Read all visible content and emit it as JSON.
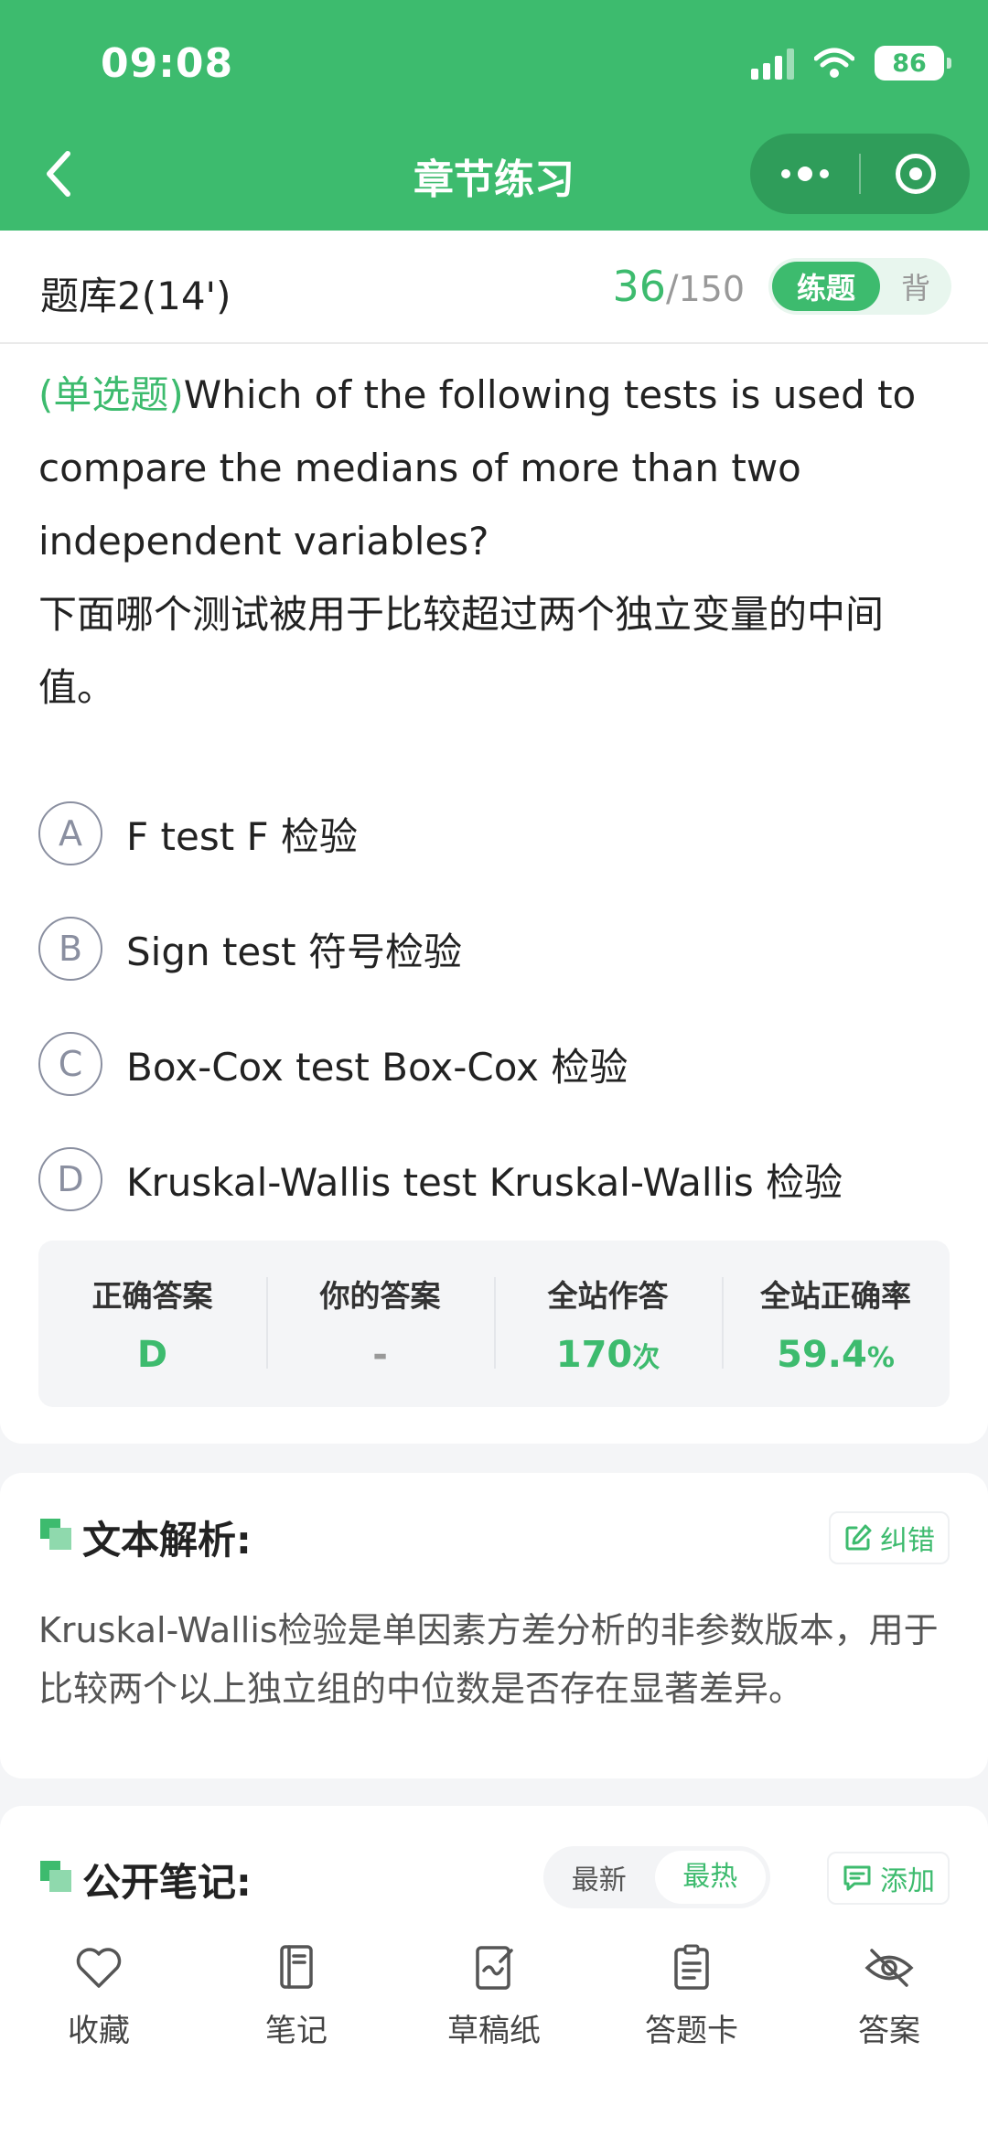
{
  "status_bar": {
    "time": "09:08",
    "battery": "86"
  },
  "nav": {
    "title": "章节练习"
  },
  "bank": {
    "name": "题库2(14')",
    "current": "36",
    "separator": "/",
    "total": "150",
    "mode_active": "练题",
    "mode_inactive": "背"
  },
  "question": {
    "type_tag": "(单选题)",
    "text_en": "Which of the following tests is used to compare the medians of more than two independent variables?",
    "text_zh": "下面哪个测试被用于比较超过两个独立变量的中间值。"
  },
  "options": [
    {
      "letter": "A",
      "text": "F test F 检验"
    },
    {
      "letter": "B",
      "text": "Sign test 符号检验"
    },
    {
      "letter": "C",
      "text": "Box-Cox test Box-Cox 检验"
    },
    {
      "letter": "D",
      "text": "Kruskal-Wallis test Kruskal-Wallis 检验"
    }
  ],
  "stats": [
    {
      "label": "正确答案",
      "value": "D",
      "unit": ""
    },
    {
      "label": "你的答案",
      "value": "-",
      "unit": ""
    },
    {
      "label": "全站作答",
      "value": "170",
      "unit": "次"
    },
    {
      "label": "全站正确率",
      "value": "59.4",
      "unit": "%"
    }
  ],
  "analysis": {
    "title": "文本解析:",
    "report_label": "纠错",
    "text": "Kruskal-Wallis检验是单因素方差分析的非参数版本，用于比较两个以上独立组的中位数是否存在显著差异。"
  },
  "notes": {
    "title": "公开笔记:",
    "sort_newest": "最新",
    "sort_hottest": "最热",
    "add_label": "添加"
  },
  "tabbar": {
    "items": [
      {
        "label": "收藏",
        "icon": "heart-icon"
      },
      {
        "label": "笔记",
        "icon": "notebook-icon"
      },
      {
        "label": "草稿纸",
        "icon": "draft-paper-icon"
      },
      {
        "label": "答题卡",
        "icon": "answer-sheet-icon"
      },
      {
        "label": "答案",
        "icon": "eye-off-icon"
      }
    ]
  },
  "colors": {
    "accent": "#3dbb6e",
    "accent_dark": "#2f9d5a",
    "background": "#f4f5f7"
  }
}
